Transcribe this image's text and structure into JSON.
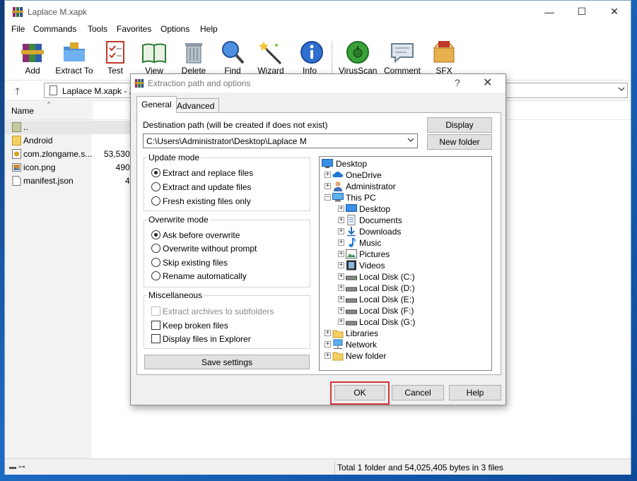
{
  "window": {
    "title": "Laplace M.xapk",
    "minimize": "—",
    "maximize": "☐",
    "close": "✕"
  },
  "menu": [
    "File",
    "Commands",
    "Tools",
    "Favorites",
    "Options",
    "Help"
  ],
  "toolbar": [
    {
      "label": "Add",
      "icon": "add-archive-icon"
    },
    {
      "label": "Extract To",
      "icon": "extract-folder-icon"
    },
    {
      "label": "Test",
      "icon": "test-checklist-icon"
    },
    {
      "label": "View",
      "icon": "view-book-icon"
    },
    {
      "label": "Delete",
      "icon": "trash-icon"
    },
    {
      "label": "Find",
      "icon": "magnifier-icon"
    },
    {
      "label": "Wizard",
      "icon": "magic-wand-icon"
    },
    {
      "label": "Info",
      "icon": "info-icon"
    },
    {
      "label": "VirusScan",
      "icon": "virus-scan-icon"
    },
    {
      "label": "Comment",
      "icon": "comment-icon"
    },
    {
      "label": "SFX",
      "icon": "sfx-box-icon"
    }
  ],
  "address": {
    "text": "Laplace M.xapk - Z",
    "up": "🡑"
  },
  "filelist": {
    "header_name": "Name",
    "sort_glyph": "^",
    "rows": [
      {
        "name": "..",
        "size": "",
        "icon": "parent-folder-icon"
      },
      {
        "name": "Android",
        "size": "",
        "icon": "folder-icon"
      },
      {
        "name": "com.zlongame.s...",
        "size": "53,530,",
        "icon": "apk-file-icon"
      },
      {
        "name": "icon.png",
        "size": "490,",
        "icon": "image-file-icon"
      },
      {
        "name": "manifest.json",
        "size": "4,",
        "icon": "text-file-icon"
      }
    ]
  },
  "status": {
    "text": "Total 1 folder and 54,025,405 bytes in 3 files",
    "icons": "▬ ⊶"
  },
  "dialog": {
    "title": "Extraction path and options",
    "help_glyph": "?",
    "close_glyph": "✕",
    "tabs": {
      "general": "General",
      "advanced": "Advanced"
    },
    "dest_label": "Destination path (will be created if does not exist)",
    "dest_value": "C:\\Users\\Administrator\\Desktop\\Laplace M",
    "display_button": "Display",
    "new_folder_button": "New folder",
    "update_mode": {
      "title": "Update mode",
      "options": [
        {
          "label": "Extract and replace files",
          "checked": true
        },
        {
          "label": "Extract and update files",
          "checked": false
        },
        {
          "label": "Fresh existing files only",
          "checked": false
        }
      ]
    },
    "overwrite_mode": {
      "title": "Overwrite mode",
      "options": [
        {
          "label": "Ask before overwrite",
          "checked": true
        },
        {
          "label": "Overwrite without prompt",
          "checked": false
        },
        {
          "label": "Skip existing files",
          "checked": false
        },
        {
          "label": "Rename automatically",
          "checked": false
        }
      ]
    },
    "misc": {
      "title": "Miscellaneous",
      "options": [
        {
          "label": "Extract archives to subfolders",
          "checked": false,
          "disabled": true
        },
        {
          "label": "Keep broken files",
          "checked": false,
          "disabled": false
        },
        {
          "label": "Display files in Explorer",
          "checked": false,
          "disabled": false
        }
      ]
    },
    "save_settings": "Save settings",
    "tree": [
      {
        "label": "Desktop",
        "level": 0,
        "expander": "",
        "icon": "desktop-icon"
      },
      {
        "label": "OneDrive",
        "level": 1,
        "expander": "+",
        "icon": "cloud-icon"
      },
      {
        "label": "Administrator",
        "level": 1,
        "expander": "+",
        "icon": "user-icon"
      },
      {
        "label": "This PC",
        "level": 1,
        "expander": "−",
        "icon": "computer-icon"
      },
      {
        "label": "Desktop",
        "level": 2,
        "expander": "+",
        "icon": "desktop-icon"
      },
      {
        "label": "Documents",
        "level": 2,
        "expander": "+",
        "icon": "documents-icon"
      },
      {
        "label": "Downloads",
        "level": 2,
        "expander": "+",
        "icon": "download-icon"
      },
      {
        "label": "Music",
        "level": 2,
        "expander": "+",
        "icon": "music-note-icon"
      },
      {
        "label": "Pictures",
        "level": 2,
        "expander": "+",
        "icon": "pictures-icon"
      },
      {
        "label": "Videos",
        "level": 2,
        "expander": "+",
        "icon": "film-icon"
      },
      {
        "label": "Local Disk (C:)",
        "level": 2,
        "expander": "+",
        "icon": "drive-icon"
      },
      {
        "label": "Local Disk (D:)",
        "level": 2,
        "expander": "+",
        "icon": "drive-icon"
      },
      {
        "label": "Local Disk (E:)",
        "level": 2,
        "expander": "+",
        "icon": "drive-icon"
      },
      {
        "label": "Local Disk (F:)",
        "level": 2,
        "expander": "+",
        "icon": "drive-icon"
      },
      {
        "label": "Local Disk (G:)",
        "level": 2,
        "expander": "+",
        "icon": "drive-icon"
      },
      {
        "label": "Libraries",
        "level": 1,
        "expander": "+",
        "icon": "libraries-icon"
      },
      {
        "label": "Network",
        "level": 1,
        "expander": "+",
        "icon": "network-icon"
      },
      {
        "label": "New folder",
        "level": 1,
        "expander": "+",
        "icon": "folder-icon"
      }
    ],
    "ok": "OK",
    "cancel": "Cancel",
    "help": "Help"
  }
}
